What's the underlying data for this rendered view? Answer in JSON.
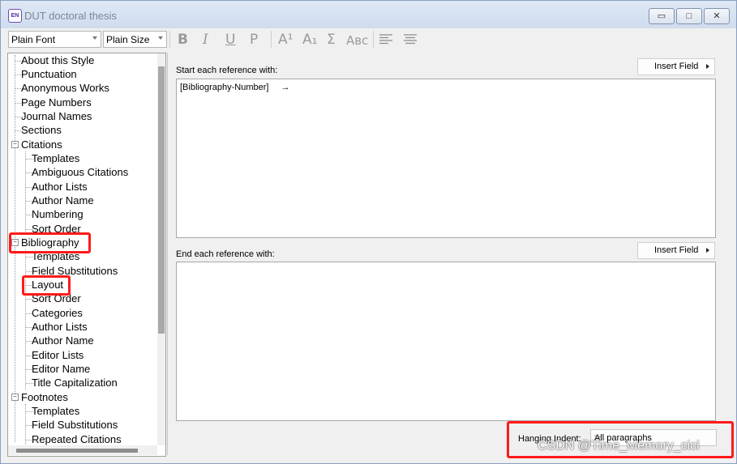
{
  "window": {
    "title": "DUT doctoral thesis",
    "app_icon_text": "EN",
    "controls": [
      "minimize-icon",
      "maximize-icon",
      "close-icon"
    ]
  },
  "toolbar": {
    "font_value": "Plain Font",
    "size_value": "Plain Size",
    "bold": "B",
    "italic": "I",
    "underline": "U",
    "plain": "P",
    "superscript": "A¹",
    "subscript": "A₁",
    "symbol": "Σ",
    "smallcaps": "Aʙᴄ",
    "align_left_icon": "align-left-icon",
    "justify_icon": "justify-icon"
  },
  "tree": {
    "items": [
      {
        "label": "About this Style"
      },
      {
        "label": "Punctuation"
      },
      {
        "label": "Anonymous Works"
      },
      {
        "label": "Page Numbers"
      },
      {
        "label": "Journal Names"
      },
      {
        "label": "Sections"
      },
      {
        "label": "Citations",
        "expander": "⊟"
      },
      {
        "label": "Templates"
      },
      {
        "label": "Ambiguous Citations"
      },
      {
        "label": "Author Lists"
      },
      {
        "label": "Author Name"
      },
      {
        "label": "Numbering"
      },
      {
        "label": "Sort Order"
      },
      {
        "label": "Bibliography",
        "expander": "⊟"
      },
      {
        "label": "Templates"
      },
      {
        "label": "Field Substitutions"
      },
      {
        "label": "Layout"
      },
      {
        "label": "Sort Order"
      },
      {
        "label": "Categories"
      },
      {
        "label": "Author Lists"
      },
      {
        "label": "Author Name"
      },
      {
        "label": "Editor Lists"
      },
      {
        "label": "Editor Name"
      },
      {
        "label": "Title Capitalization"
      },
      {
        "label": "Footnotes",
        "expander": "⊟"
      },
      {
        "label": "Templates"
      },
      {
        "label": "Field Substitutions"
      },
      {
        "label": "Repeated Citations"
      }
    ]
  },
  "start_section": {
    "label": "Start each reference with:",
    "insert_button": "Insert Field",
    "content": "[Bibliography-Number]",
    "tab_glyph": "→"
  },
  "end_section": {
    "label": "End each reference with:",
    "insert_button": "Insert Field",
    "content": ""
  },
  "hanging_indent": {
    "label": "Hanging Indent:",
    "value": "All paragraphs"
  },
  "watermark": "CSDN @Time_Memory_cici",
  "colors": {
    "highlight": "#ff1a1a",
    "titlebar": "#cfdcee"
  }
}
